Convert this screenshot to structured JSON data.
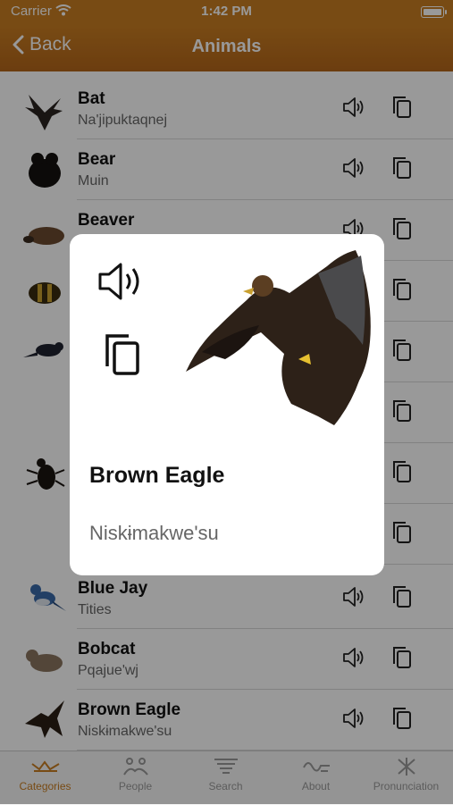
{
  "status": {
    "carrier": "Carrier",
    "time": "1:42 PM"
  },
  "nav": {
    "back_label": "Back",
    "title": "Animals"
  },
  "rows": [
    {
      "name": "Bat",
      "translation": "Na'jipuktaqnej",
      "icon": "bat-image"
    },
    {
      "name": "Bear",
      "translation": "Muin",
      "icon": "bear-image"
    },
    {
      "name": "Beaver",
      "translation": "",
      "icon": "beaver-image"
    },
    {
      "name": "",
      "translation": "",
      "icon": "bee-image"
    },
    {
      "name": "",
      "translation": "",
      "icon": "blackbird-image"
    },
    {
      "name": "",
      "translation": "",
      "icon": ""
    },
    {
      "name": "",
      "translation": "",
      "icon": "beetle-image"
    },
    {
      "name": "",
      "translation": "",
      "icon": ""
    },
    {
      "name": "Blue Jay",
      "translation": "Tities",
      "icon": "blue-jay-image"
    },
    {
      "name": "Bobcat",
      "translation": "Pqajue'wj",
      "icon": "bobcat-image"
    },
    {
      "name": "Brown Eagle",
      "translation": "Niskɨmakwe'su",
      "icon": "brown-eagle-image"
    }
  ],
  "popup": {
    "title": "Brown Eagle",
    "translation": "Niskɨmakwe'su",
    "icons": [
      "speaker-icon",
      "copy-icon"
    ]
  },
  "tabs": [
    {
      "label": "Categories",
      "active": true
    },
    {
      "label": "People",
      "active": false
    },
    {
      "label": "Search",
      "active": false
    },
    {
      "label": "About",
      "active": false
    },
    {
      "label": "Pronunciation",
      "active": false
    }
  ],
  "colors": {
    "accent": "#c97e22",
    "nav_dark": "#b4661a"
  }
}
